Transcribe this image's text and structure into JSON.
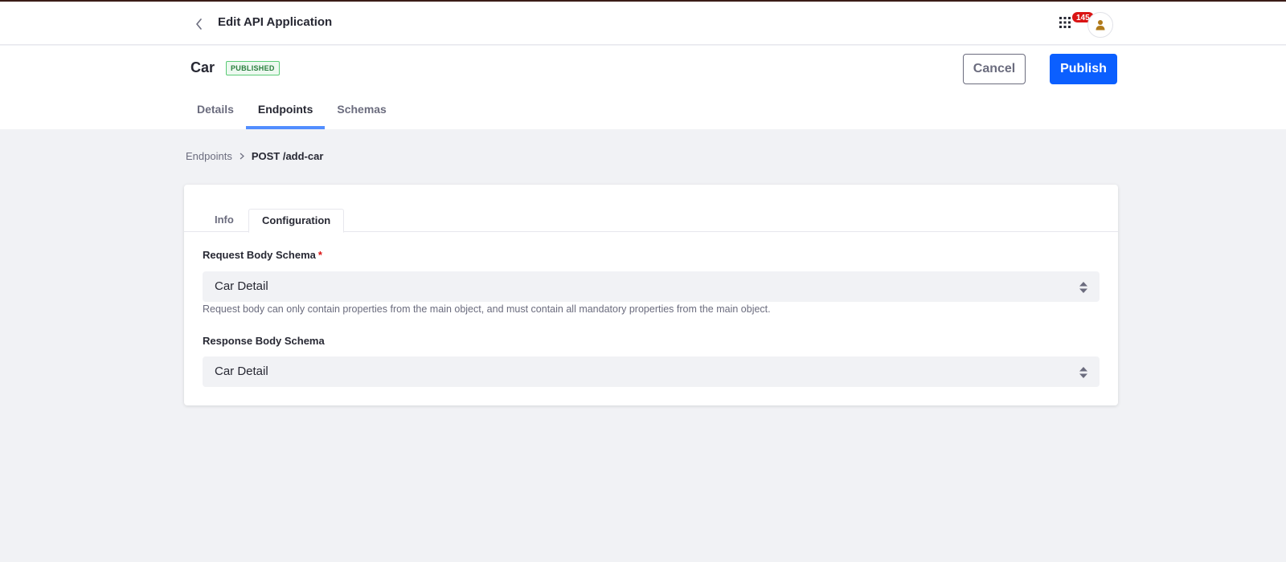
{
  "header": {
    "title": "Edit API Application",
    "notification_count": "145"
  },
  "entity": {
    "name": "Car",
    "status": "PUBLISHED"
  },
  "actions": {
    "cancel_label": "Cancel",
    "publish_label": "Publish"
  },
  "nav_tabs": [
    {
      "label": "Details",
      "active": false
    },
    {
      "label": "Endpoints",
      "active": true
    },
    {
      "label": "Schemas",
      "active": false
    }
  ],
  "breadcrumb": {
    "parent": "Endpoints",
    "current": "POST /add-car"
  },
  "card": {
    "tabs": [
      {
        "label": "Info",
        "active": false
      },
      {
        "label": "Configuration",
        "active": true
      }
    ],
    "request_schema": {
      "label": "Request Body Schema",
      "required_mark": "*",
      "value": "Car Detail",
      "help": "Request body can only contain properties from the main object, and must contain all mandatory properties from the main object."
    },
    "response_schema": {
      "label": "Response Body Schema",
      "value": "Car Detail"
    }
  },
  "colors": {
    "primary": "#0b5fff",
    "active_tab_indicator": "#528eff",
    "published_text": "#287d3c",
    "badge": "#da1414",
    "page_background": "#f1f2f5"
  },
  "icons": {
    "back": "chevron-left-icon",
    "apps": "grid-icon",
    "avatar": "user-icon",
    "breadcrumb_separator": "chevron-right-icon",
    "select": "caret-double-icon"
  }
}
